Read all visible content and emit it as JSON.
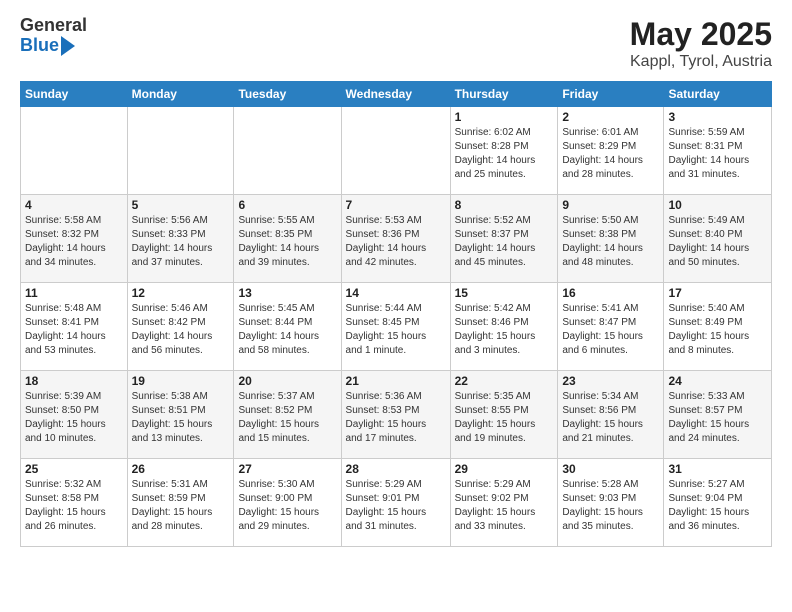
{
  "logo": {
    "general": "General",
    "blue": "Blue"
  },
  "title": "May 2025",
  "subtitle": "Kappl, Tyrol, Austria",
  "weekdays": [
    "Sunday",
    "Monday",
    "Tuesday",
    "Wednesday",
    "Thursday",
    "Friday",
    "Saturday"
  ],
  "weeks": [
    [
      {
        "day": "",
        "info": ""
      },
      {
        "day": "",
        "info": ""
      },
      {
        "day": "",
        "info": ""
      },
      {
        "day": "",
        "info": ""
      },
      {
        "day": "1",
        "info": "Sunrise: 6:02 AM\nSunset: 8:28 PM\nDaylight: 14 hours\nand 25 minutes."
      },
      {
        "day": "2",
        "info": "Sunrise: 6:01 AM\nSunset: 8:29 PM\nDaylight: 14 hours\nand 28 minutes."
      },
      {
        "day": "3",
        "info": "Sunrise: 5:59 AM\nSunset: 8:31 PM\nDaylight: 14 hours\nand 31 minutes."
      }
    ],
    [
      {
        "day": "4",
        "info": "Sunrise: 5:58 AM\nSunset: 8:32 PM\nDaylight: 14 hours\nand 34 minutes."
      },
      {
        "day": "5",
        "info": "Sunrise: 5:56 AM\nSunset: 8:33 PM\nDaylight: 14 hours\nand 37 minutes."
      },
      {
        "day": "6",
        "info": "Sunrise: 5:55 AM\nSunset: 8:35 PM\nDaylight: 14 hours\nand 39 minutes."
      },
      {
        "day": "7",
        "info": "Sunrise: 5:53 AM\nSunset: 8:36 PM\nDaylight: 14 hours\nand 42 minutes."
      },
      {
        "day": "8",
        "info": "Sunrise: 5:52 AM\nSunset: 8:37 PM\nDaylight: 14 hours\nand 45 minutes."
      },
      {
        "day": "9",
        "info": "Sunrise: 5:50 AM\nSunset: 8:38 PM\nDaylight: 14 hours\nand 48 minutes."
      },
      {
        "day": "10",
        "info": "Sunrise: 5:49 AM\nSunset: 8:40 PM\nDaylight: 14 hours\nand 50 minutes."
      }
    ],
    [
      {
        "day": "11",
        "info": "Sunrise: 5:48 AM\nSunset: 8:41 PM\nDaylight: 14 hours\nand 53 minutes."
      },
      {
        "day": "12",
        "info": "Sunrise: 5:46 AM\nSunset: 8:42 PM\nDaylight: 14 hours\nand 56 minutes."
      },
      {
        "day": "13",
        "info": "Sunrise: 5:45 AM\nSunset: 8:44 PM\nDaylight: 14 hours\nand 58 minutes."
      },
      {
        "day": "14",
        "info": "Sunrise: 5:44 AM\nSunset: 8:45 PM\nDaylight: 15 hours\nand 1 minute."
      },
      {
        "day": "15",
        "info": "Sunrise: 5:42 AM\nSunset: 8:46 PM\nDaylight: 15 hours\nand 3 minutes."
      },
      {
        "day": "16",
        "info": "Sunrise: 5:41 AM\nSunset: 8:47 PM\nDaylight: 15 hours\nand 6 minutes."
      },
      {
        "day": "17",
        "info": "Sunrise: 5:40 AM\nSunset: 8:49 PM\nDaylight: 15 hours\nand 8 minutes."
      }
    ],
    [
      {
        "day": "18",
        "info": "Sunrise: 5:39 AM\nSunset: 8:50 PM\nDaylight: 15 hours\nand 10 minutes."
      },
      {
        "day": "19",
        "info": "Sunrise: 5:38 AM\nSunset: 8:51 PM\nDaylight: 15 hours\nand 13 minutes."
      },
      {
        "day": "20",
        "info": "Sunrise: 5:37 AM\nSunset: 8:52 PM\nDaylight: 15 hours\nand 15 minutes."
      },
      {
        "day": "21",
        "info": "Sunrise: 5:36 AM\nSunset: 8:53 PM\nDaylight: 15 hours\nand 17 minutes."
      },
      {
        "day": "22",
        "info": "Sunrise: 5:35 AM\nSunset: 8:55 PM\nDaylight: 15 hours\nand 19 minutes."
      },
      {
        "day": "23",
        "info": "Sunrise: 5:34 AM\nSunset: 8:56 PM\nDaylight: 15 hours\nand 21 minutes."
      },
      {
        "day": "24",
        "info": "Sunrise: 5:33 AM\nSunset: 8:57 PM\nDaylight: 15 hours\nand 24 minutes."
      }
    ],
    [
      {
        "day": "25",
        "info": "Sunrise: 5:32 AM\nSunset: 8:58 PM\nDaylight: 15 hours\nand 26 minutes."
      },
      {
        "day": "26",
        "info": "Sunrise: 5:31 AM\nSunset: 8:59 PM\nDaylight: 15 hours\nand 28 minutes."
      },
      {
        "day": "27",
        "info": "Sunrise: 5:30 AM\nSunset: 9:00 PM\nDaylight: 15 hours\nand 29 minutes."
      },
      {
        "day": "28",
        "info": "Sunrise: 5:29 AM\nSunset: 9:01 PM\nDaylight: 15 hours\nand 31 minutes."
      },
      {
        "day": "29",
        "info": "Sunrise: 5:29 AM\nSunset: 9:02 PM\nDaylight: 15 hours\nand 33 minutes."
      },
      {
        "day": "30",
        "info": "Sunrise: 5:28 AM\nSunset: 9:03 PM\nDaylight: 15 hours\nand 35 minutes."
      },
      {
        "day": "31",
        "info": "Sunrise: 5:27 AM\nSunset: 9:04 PM\nDaylight: 15 hours\nand 36 minutes."
      }
    ]
  ]
}
